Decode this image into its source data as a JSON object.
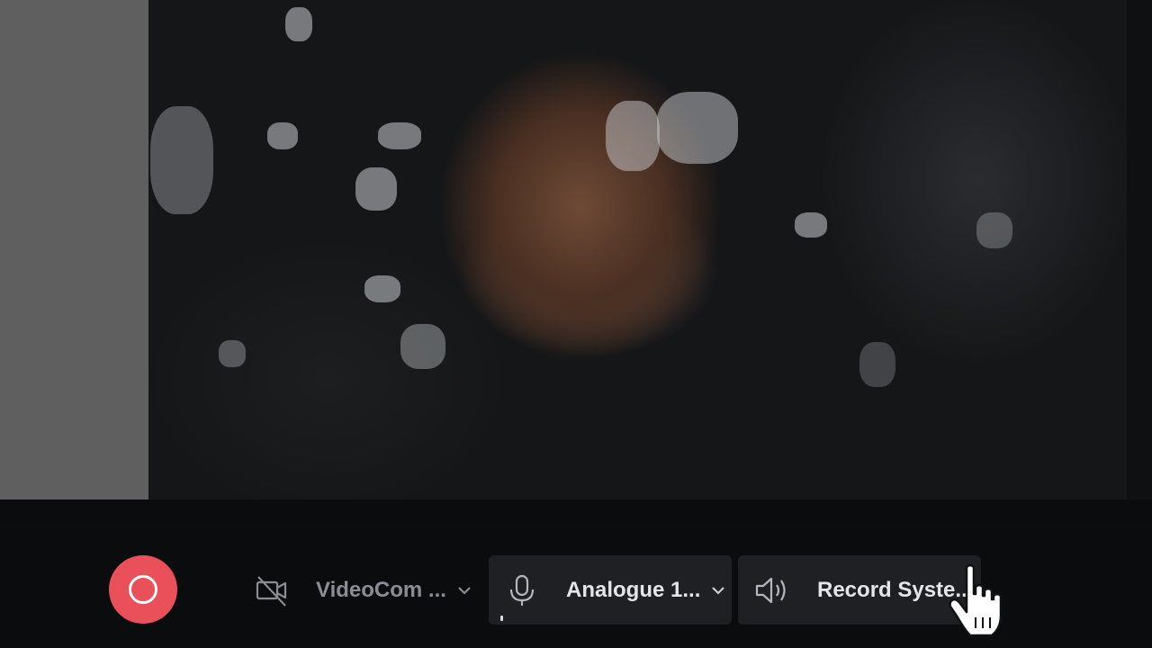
{
  "preview": {
    "side_strip_color": "#5f5f5f"
  },
  "toolbar": {
    "record_button": {
      "color": "#e9505a",
      "icon": "record-circle-icon"
    },
    "camera": {
      "label": "VideoCom ...",
      "icon": "camera-off-icon",
      "enabled": false
    },
    "microphone": {
      "label": "Analogue 1...",
      "icon": "microphone-icon"
    },
    "system_audio": {
      "label": "Record Syste...",
      "icon": "speaker-icon"
    }
  },
  "cursor": {
    "type": "pointer-hand-icon"
  }
}
